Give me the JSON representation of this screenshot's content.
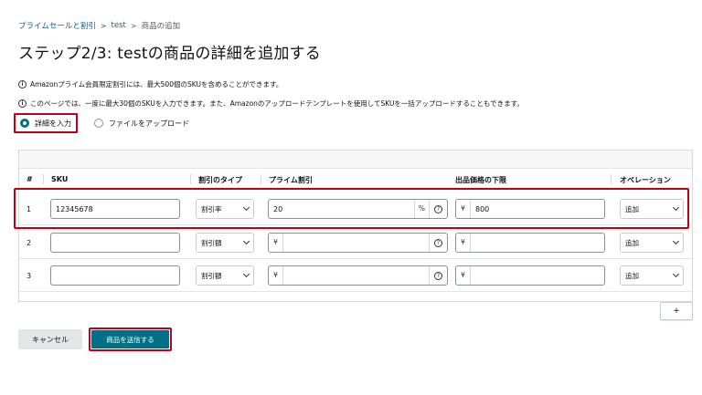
{
  "breadcrumb": {
    "items": [
      "プライムセールと割引",
      "test",
      "商品の追加"
    ],
    "separator": ">"
  },
  "page_title": "ステップ2/3: testの商品の詳細を追加する",
  "info": [
    "Amazonプライム会員限定割引には、最大500個のSKUを含めることができます。",
    "このページでは、一度に最大30個のSKUを入力できます。また、Amazonのアップロードテンプレートを使用してSKUを一括アップロードすることもできます。"
  ],
  "input_mode": {
    "options": [
      "詳細を入力",
      "ファイルをアップロード"
    ],
    "selected": "詳細を入力"
  },
  "table": {
    "headers": {
      "num": "#",
      "sku": "SKU",
      "discount_type": "割引のタイプ",
      "prime_discount": "プライム割引",
      "min_price": "出品価格の下限",
      "operation": "オペレーション"
    },
    "rows": [
      {
        "num": "1",
        "sku": "12345678",
        "discount_type": "割引率",
        "unit": "%",
        "prime_discount": "20",
        "currency": "¥",
        "min_price": "800",
        "operation": "追加"
      },
      {
        "num": "2",
        "sku": "",
        "discount_type": "割引額",
        "unit": "¥",
        "prime_discount": "",
        "currency": "¥",
        "min_price": "",
        "operation": "追加"
      },
      {
        "num": "3",
        "sku": "",
        "discount_type": "割引額",
        "unit": "¥",
        "prime_discount": "",
        "currency": "¥",
        "min_price": "",
        "operation": "追加"
      }
    ]
  },
  "buttons": {
    "add_row": "+",
    "cancel": "キャンセル",
    "submit": "商品を送信する"
  },
  "colors": {
    "accent": "#007185",
    "highlight": "#c0001a",
    "link": "#0f5e8a"
  }
}
